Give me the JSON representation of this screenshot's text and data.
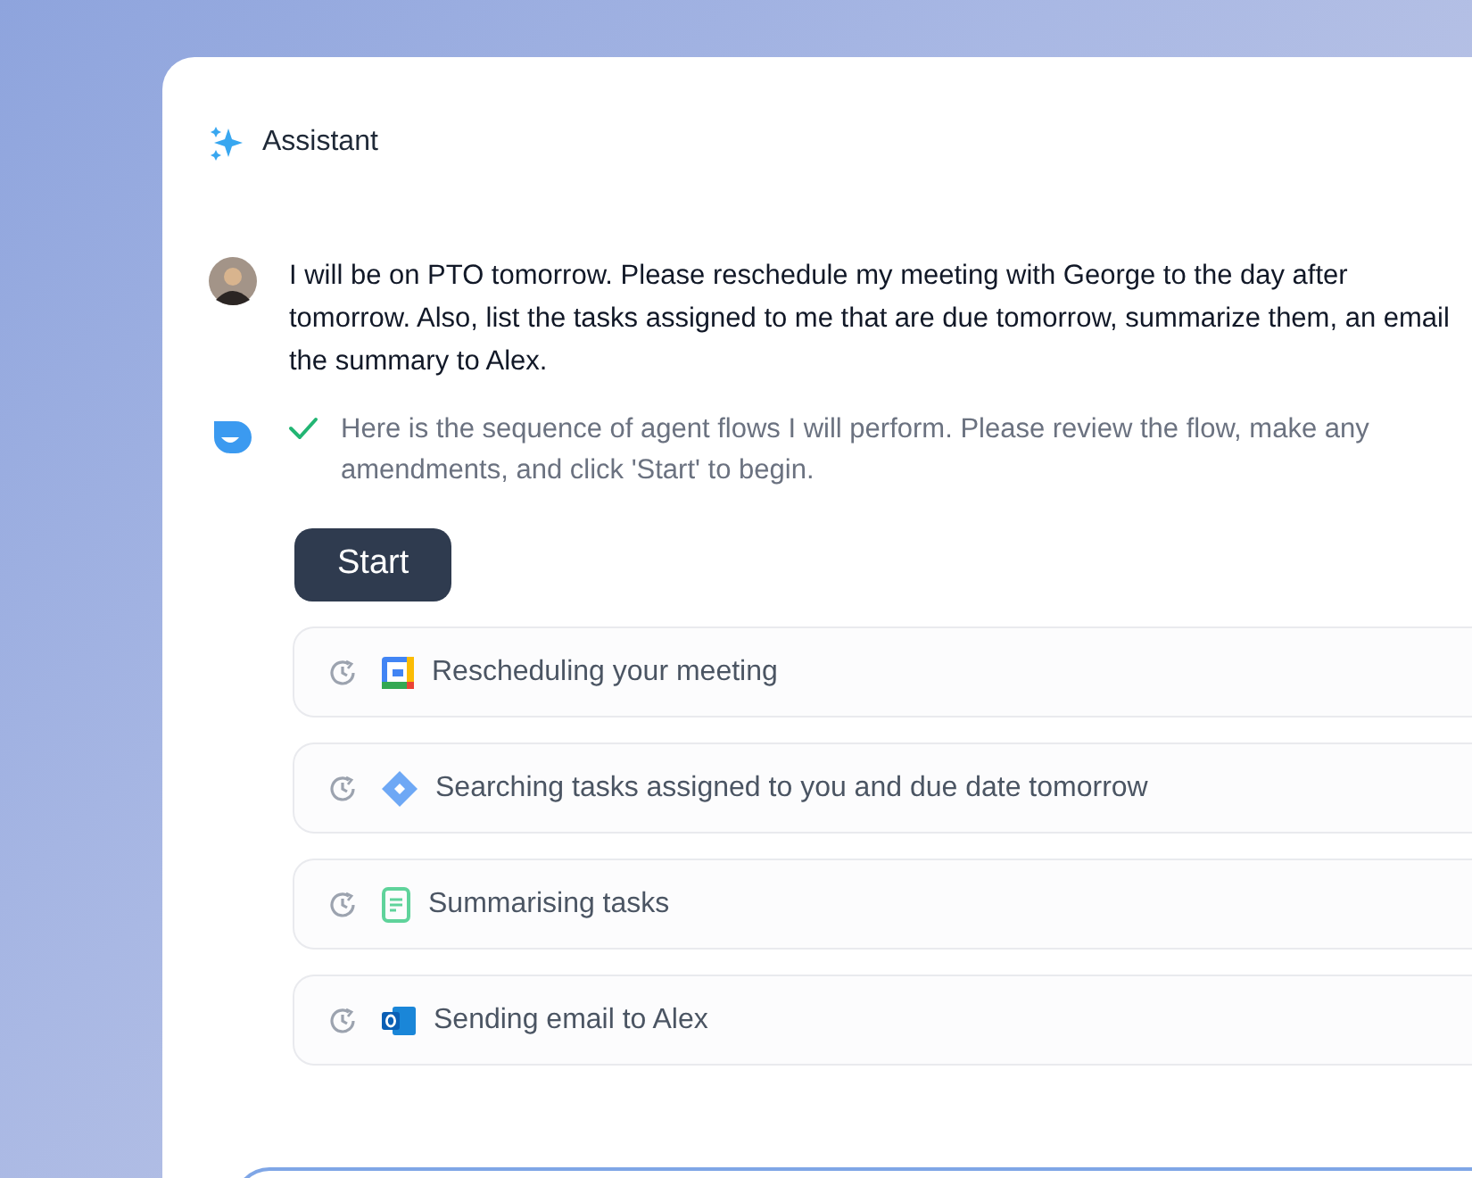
{
  "header": {
    "title": "Assistant"
  },
  "user_message": {
    "text": "I will be on PTO tomorrow. Please reschedule my meeting with George to the day after tomorrow. Also, list the tasks assigned to me that are due tomorrow, summarize them, an email the summary to Alex."
  },
  "assistant_message": {
    "done": true,
    "text": "Here is the sequence of agent flows I will perform. Please review the flow, make any amendments, and click 'Start' to begin."
  },
  "start_button": {
    "label": "Start"
  },
  "steps": [
    {
      "kind": "calendar",
      "pending": true,
      "label": "Rescheduling your meeting"
    },
    {
      "kind": "task",
      "pending": true,
      "label": "Searching tasks assigned to you and due date tomorrow"
    },
    {
      "kind": "document",
      "pending": true,
      "label": "Summarising tasks"
    },
    {
      "kind": "email",
      "pending": true,
      "label": "Sending email to Alex"
    }
  ]
}
